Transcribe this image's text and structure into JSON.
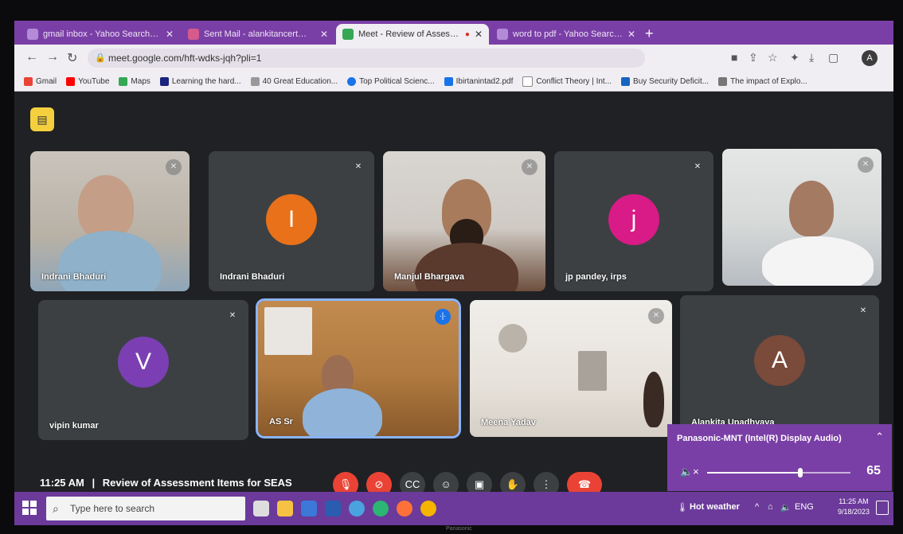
{
  "browser": {
    "tabs": [
      {
        "title": "gmail inbox - Yahoo Search Res",
        "active": false
      },
      {
        "title": "Sent Mail - alankitancert@gmail",
        "active": false
      },
      {
        "title": "Meet - Review of Assessme",
        "active": true
      },
      {
        "title": "word to pdf - Yahoo Search Res",
        "active": false
      }
    ],
    "new_tab": "+",
    "url": "meet.google.com/hft-wdks-jqh?pli=1",
    "bookmarks": [
      "Gmail",
      "YouTube",
      "Maps",
      "Learning the hard...",
      "40 Great Education...",
      "Top Political Scienc...",
      "Ibirtanintad2.pdf",
      "Conflict Theory | Int...",
      "Buy Security Deficit...",
      "The impact of Explo..."
    ]
  },
  "meet": {
    "participants": [
      {
        "name": "Indrani Bhaduri",
        "mic": "muted"
      },
      {
        "name": "Indrani Bhaduri",
        "avatar_letter": "I",
        "avatar_color": "#e8711a",
        "mic": "muted"
      },
      {
        "name": "Manjul Bhargava",
        "mic": "muted"
      },
      {
        "name": "jp pandey, irps",
        "avatar_letter": "j",
        "avatar_color": "#d81b86",
        "mic": "muted"
      },
      {
        "name": "",
        "mic": "muted"
      },
      {
        "name": "vipin kumar",
        "avatar_letter": "V",
        "avatar_color": "#7b3fb3",
        "mic": "muted"
      },
      {
        "name": "AS Sr",
        "mic": "speaking"
      },
      {
        "name": "Meena Yadav",
        "mic": "muted"
      },
      {
        "name": "Alankita Upadhyaya",
        "avatar_letter": "A",
        "avatar_color": "#7a4a3a",
        "mic": "muted"
      }
    ],
    "time": "11:25 AM",
    "separator": "|",
    "meeting_title": "Review of Assessment Items for SEAS",
    "controls": [
      "mic-off",
      "camera-off",
      "captions",
      "emoji",
      "present",
      "raise-hand",
      "more",
      "end-call"
    ]
  },
  "volume_flyout": {
    "device": "Panasonic-MNT (Intel(R) Display Audio)",
    "level": 65
  },
  "taskbar": {
    "search_placeholder": "Type here to search",
    "weather": "Hot weather",
    "time": "11:25 AM",
    "date": "9/18/2023"
  },
  "monitor_brand": "Panasonic"
}
